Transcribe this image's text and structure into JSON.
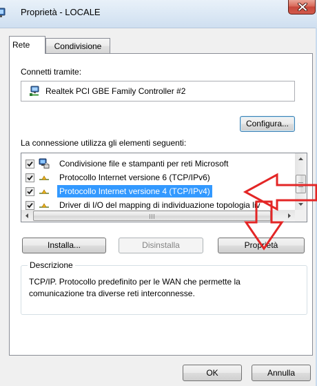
{
  "window": {
    "title": "Proprietà - LOCALE",
    "icon": "network-connection-icon",
    "close_icon": "close-icon"
  },
  "tabs": [
    {
      "label": "Rete",
      "selected": true
    },
    {
      "label": "Condivisione",
      "selected": false
    }
  ],
  "connect": {
    "label": "Connetti tramite:",
    "adapter_name": "Realtek PCI GBE Family Controller #2",
    "adapter_icon": "network-adapter-icon",
    "configure_label": "Configura..."
  },
  "components": {
    "label": "La connessione utilizza gli elementi seguenti:",
    "items": [
      {
        "label": "Condivisione file e stampanti per reti Microsoft",
        "checked": true,
        "selected": false,
        "icon": "file-printer-sharing-icon"
      },
      {
        "label": "Protocollo Internet versione 6 (TCP/IPv6)",
        "checked": true,
        "selected": false,
        "icon": "network-protocol-icon"
      },
      {
        "label": "Protocollo Internet versione 4 (TCP/IPv4)",
        "checked": true,
        "selected": true,
        "icon": "network-protocol-icon"
      },
      {
        "label": "Driver di I/O del mapping di individuazione topologia liv",
        "checked": true,
        "selected": false,
        "icon": "network-protocol-icon"
      }
    ],
    "vertical_scroll": {
      "position": 0.67,
      "visible_fraction": 0.57
    },
    "horizontal_scroll": {
      "position": 0,
      "visible_fraction": 0.95
    }
  },
  "actions": {
    "install": "Installa...",
    "uninstall": "Disinstalla",
    "properties": "Proprietà"
  },
  "description": {
    "title": "Descrizione",
    "text": "TCP/IP. Protocollo predefinito per le WAN che permette la comunicazione tra diverse reti interconnesse."
  },
  "footer": {
    "ok": "OK",
    "cancel": "Annulla"
  },
  "colors": {
    "selection": "#3399ff",
    "annotation": "#e32626",
    "close_button": "#c7483b"
  }
}
